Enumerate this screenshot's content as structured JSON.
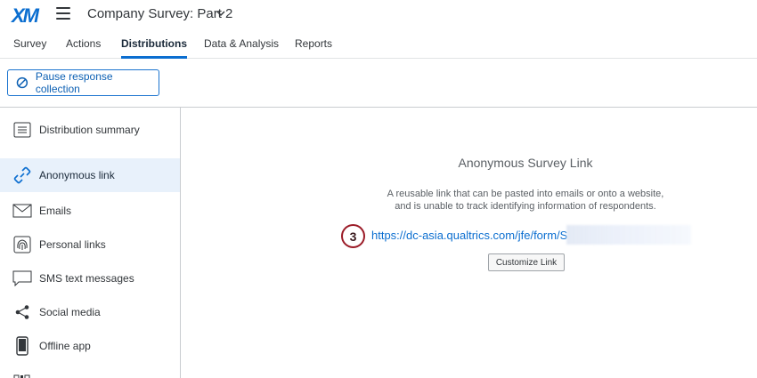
{
  "header": {
    "logo_text": "XM",
    "survey_title": "Company Survey: Part 2"
  },
  "tabs": [
    {
      "label": "Survey"
    },
    {
      "label": "Actions"
    },
    {
      "label": "Distributions",
      "active": true
    },
    {
      "label": "Data & Analysis"
    },
    {
      "label": "Reports"
    }
  ],
  "toolbar": {
    "pause_label": "Pause response collection"
  },
  "sidebar": {
    "items": [
      {
        "label": "Distribution summary",
        "icon": "list-icon"
      },
      {
        "label": "Anonymous link",
        "icon": "link-icon",
        "active": true
      },
      {
        "label": "Emails",
        "icon": "envelope-icon"
      },
      {
        "label": "Personal links",
        "icon": "fingerprint-icon"
      },
      {
        "label": "SMS text messages",
        "icon": "chat-bubble-icon"
      },
      {
        "label": "Social media",
        "icon": "share-icon"
      },
      {
        "label": "Offline app",
        "icon": "phone-icon"
      }
    ]
  },
  "main": {
    "title": "Anonymous Survey Link",
    "description_line1": "A reusable link that can be pasted into emails or onto a website,",
    "description_line2": "and is unable to track identifying information of respondents.",
    "step_number": "3",
    "link_text": "https://dc-asia.qualtrics.com/jfe/form/S",
    "customize_label": "Customize Link"
  },
  "colors": {
    "accent": "#0b6ed0",
    "step_ring": "#9b1b27",
    "active_bg": "#e8f1fb"
  }
}
